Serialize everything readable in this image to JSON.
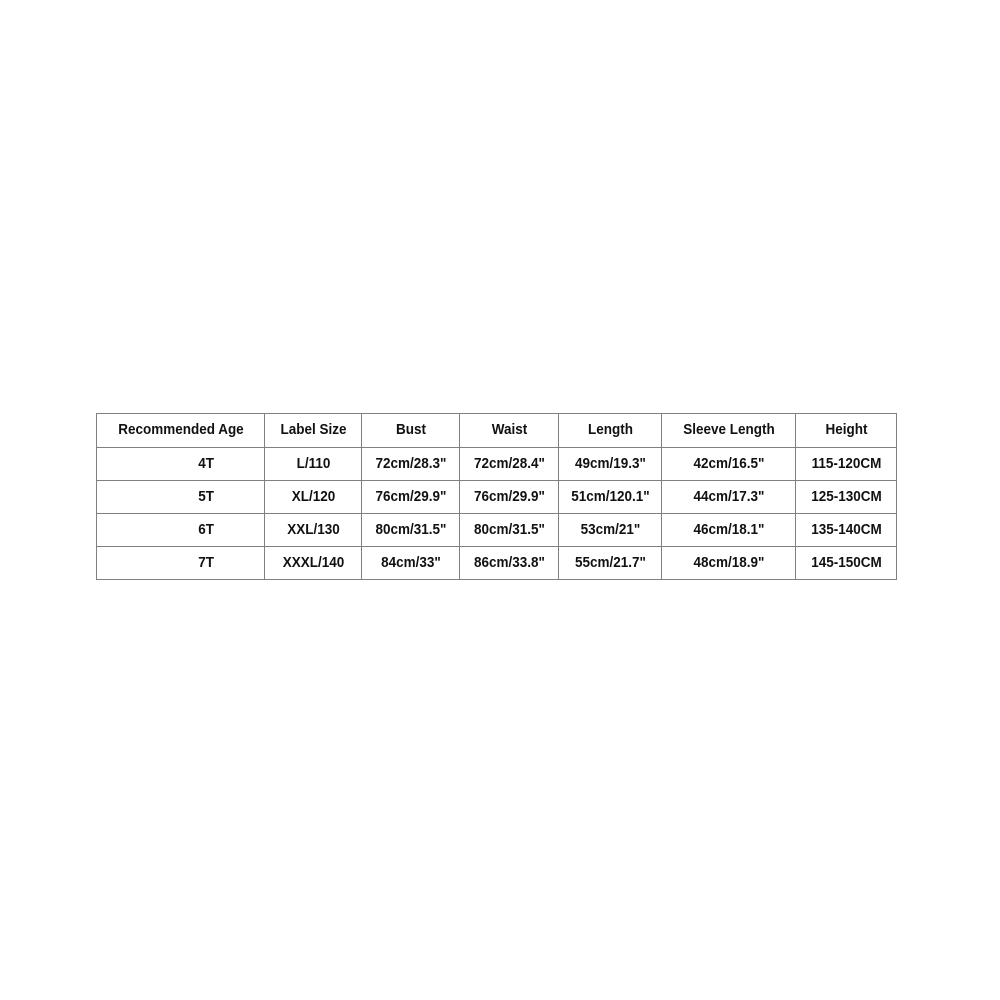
{
  "page": {
    "background_color": "#ffffff",
    "text_color": "#111111",
    "border_color": "#808080"
  },
  "size_chart": {
    "name": "garment-size-chart",
    "columns": [
      "Recommended Age",
      "Label Size",
      "Bust",
      "Waist",
      "Length",
      "Sleeve Length",
      "Height"
    ],
    "rows": [
      {
        "age": "4T",
        "label_size": "L/110",
        "bust": "72cm/28.3\"",
        "waist": "72cm/28.4\"",
        "length": "49cm/19.3\"",
        "sleeve_length": "42cm/16.5\"",
        "height": "115-120CM"
      },
      {
        "age": "5T",
        "label_size": "XL/120",
        "bust": "76cm/29.9\"",
        "waist": "76cm/29.9\"",
        "length": "51cm/120.1\"",
        "sleeve_length": "44cm/17.3\"",
        "height": "125-130CM"
      },
      {
        "age": "6T",
        "label_size": "XXL/130",
        "bust": "80cm/31.5\"",
        "waist": "80cm/31.5\"",
        "length": "53cm/21\"",
        "sleeve_length": "46cm/18.1\"",
        "height": "135-140CM"
      },
      {
        "age": "7T",
        "label_size": "XXXL/140",
        "bust": "84cm/33\"",
        "waist": "86cm/33.8\"",
        "length": "55cm/21.7\"",
        "sleeve_length": "48cm/18.9\"",
        "height": "145-150CM"
      }
    ]
  }
}
